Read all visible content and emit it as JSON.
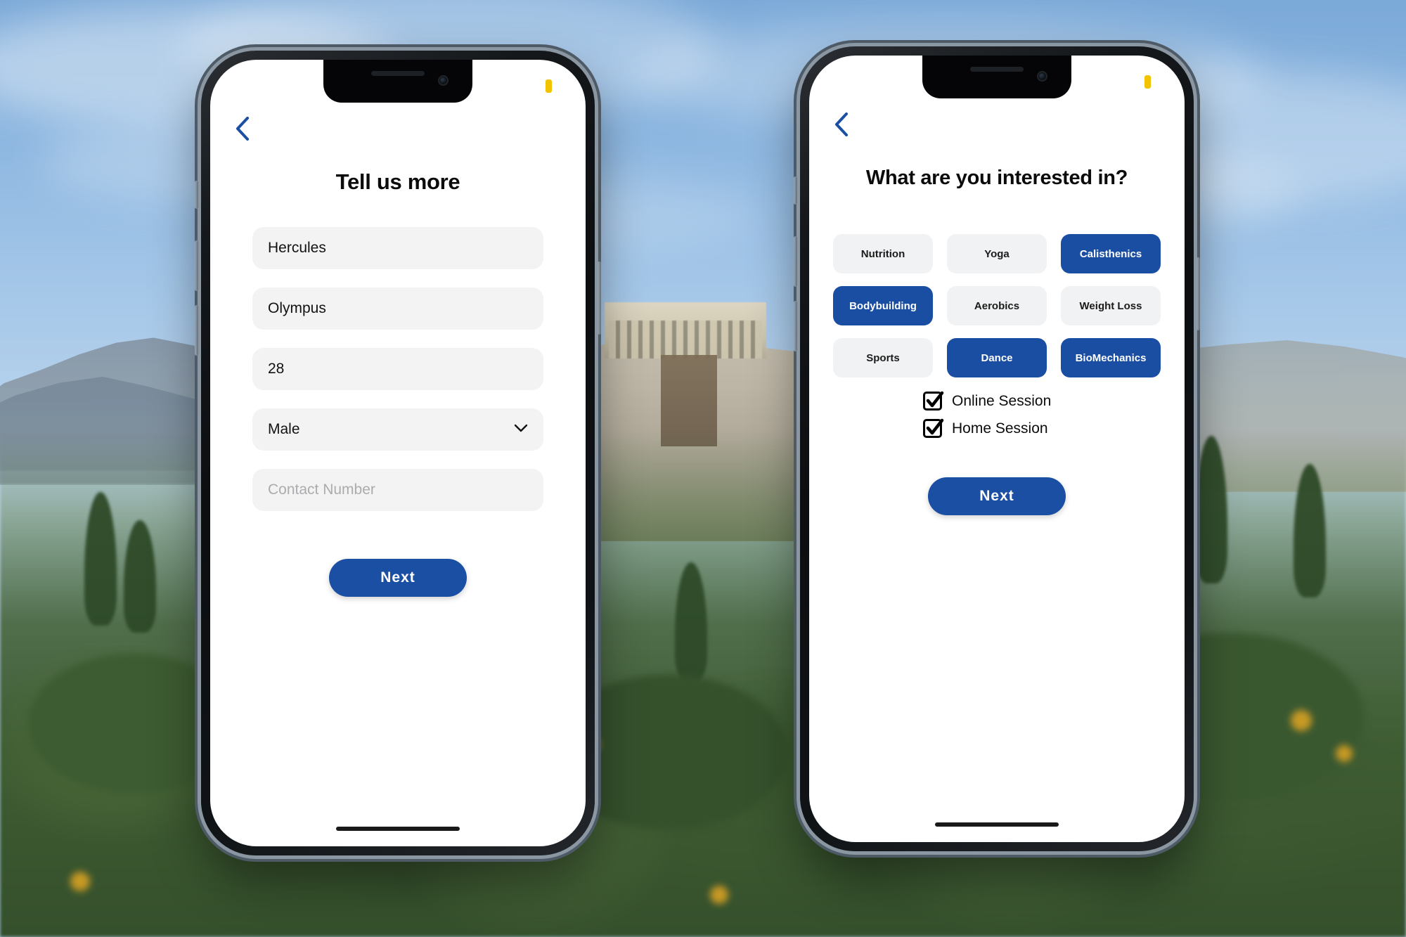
{
  "background": {
    "description": "Acropolis of Athens hillside with blue sky and green foreground vegetation"
  },
  "theme": {
    "accent_blue": "#1A4FA3",
    "chip_unselected_bg": "#F1F2F3",
    "field_bg": "#F3F3F4",
    "battery_indicator": "#F2C300",
    "text_primary": "#0B0B0B",
    "placeholder_text": "#ACACAE"
  },
  "phones": [
    {
      "id": "phone-left",
      "status_bar": {
        "battery_icon": "battery-icon"
      },
      "nav": {
        "back_icon": "chevron-left-icon"
      },
      "title": "Tell us more",
      "fields": [
        {
          "name": "first-name",
          "value": "Hercules",
          "placeholder": "First Name",
          "type": "text"
        },
        {
          "name": "last-name",
          "value": "Olympus",
          "placeholder": "Last Name",
          "type": "text"
        },
        {
          "name": "age",
          "value": "28",
          "placeholder": "Age",
          "type": "text"
        },
        {
          "name": "gender",
          "value": "Male",
          "placeholder": "Gender",
          "type": "select",
          "icon": "chevron-down-icon"
        },
        {
          "name": "contact-number",
          "value": "",
          "placeholder": "Contact Number",
          "type": "text"
        }
      ],
      "primary_button": "Next"
    },
    {
      "id": "phone-right",
      "status_bar": {
        "battery_icon": "battery-icon"
      },
      "nav": {
        "back_icon": "chevron-left-icon"
      },
      "title": "What are you interested in?",
      "interests": [
        {
          "label": "Nutrition",
          "selected": false
        },
        {
          "label": "Yoga",
          "selected": false
        },
        {
          "label": "Calisthenics",
          "selected": true
        },
        {
          "label": "Bodybuilding",
          "selected": true
        },
        {
          "label": "Aerobics",
          "selected": false
        },
        {
          "label": "Weight Loss",
          "selected": false
        },
        {
          "label": "Sports",
          "selected": false
        },
        {
          "label": "Dance",
          "selected": true
        },
        {
          "label": "BioMechanics",
          "selected": true
        }
      ],
      "sessions": [
        {
          "label": "Online Session",
          "checked": true
        },
        {
          "label": "Home Session",
          "checked": true
        }
      ],
      "primary_button": "Next"
    }
  ]
}
